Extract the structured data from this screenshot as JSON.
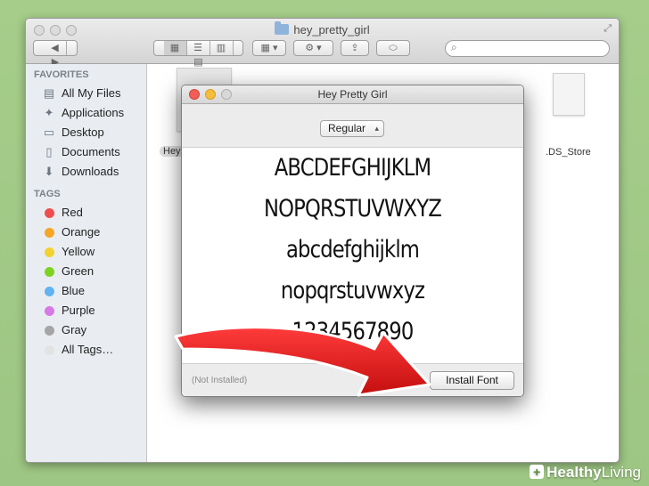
{
  "finder": {
    "title": "hey_pretty_girl",
    "search_placeholder": ""
  },
  "sidebar": {
    "favorites_header": "FAVORITES",
    "favorites": [
      {
        "label": "All My Files",
        "icon": "all-files-icon"
      },
      {
        "label": "Applications",
        "icon": "applications-icon"
      },
      {
        "label": "Desktop",
        "icon": "desktop-icon"
      },
      {
        "label": "Documents",
        "icon": "documents-icon"
      },
      {
        "label": "Downloads",
        "icon": "downloads-icon"
      }
    ],
    "tags_header": "TAGS",
    "tags": [
      {
        "label": "Red",
        "color": "#f04e4e"
      },
      {
        "label": "Orange",
        "color": "#f5a623"
      },
      {
        "label": "Yellow",
        "color": "#f3d230"
      },
      {
        "label": "Green",
        "color": "#7ed321"
      },
      {
        "label": "Blue",
        "color": "#62b3f0"
      },
      {
        "label": "Purple",
        "color": "#d77ae6"
      },
      {
        "label": "Gray",
        "color": "#a5a5a5"
      },
      {
        "label": "All Tags…",
        "color": "#e3e3e3"
      }
    ]
  },
  "files": {
    "partial_label": "Hey",
    "ds_store_label": ".DS_Store"
  },
  "font_window": {
    "title": "Hey Pretty Girl",
    "style_value": "Regular",
    "preview_lines": [
      "ABCDEFGHIJKLM",
      "NOPQRSTUVWXYZ",
      "abcdefghijklm",
      "nopqrstuvwxyz",
      "1234567890"
    ],
    "status": "(Not Installed)",
    "install_label": "Install Font"
  },
  "watermark": {
    "healthy": "Healthy",
    "living": "Living"
  }
}
